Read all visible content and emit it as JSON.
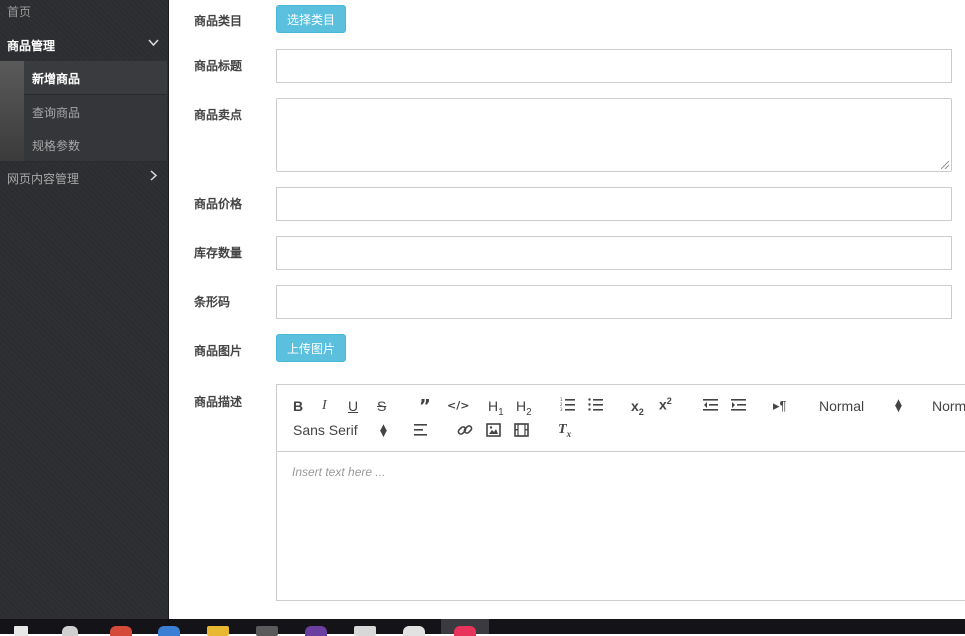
{
  "sidebar": {
    "home": "首页",
    "goods_section": "商品管理",
    "goods_items": [
      "新增商品",
      "查询商品",
      "规格参数"
    ],
    "web_section": "网页内容管理"
  },
  "form": {
    "category_label": "商品类目",
    "category_button": "选择类目",
    "title_label": "商品标题",
    "sellpoint_label": "商品卖点",
    "price_label": "商品价格",
    "stock_label": "库存数量",
    "barcode_label": "条形码",
    "image_label": "商品图片",
    "upload_button": "上传图片",
    "desc_label": "商品描述"
  },
  "editor": {
    "header_select": "Normal",
    "size_select": "Normal",
    "font_select": "Sans Serif",
    "placeholder": "Insert text here ..."
  }
}
